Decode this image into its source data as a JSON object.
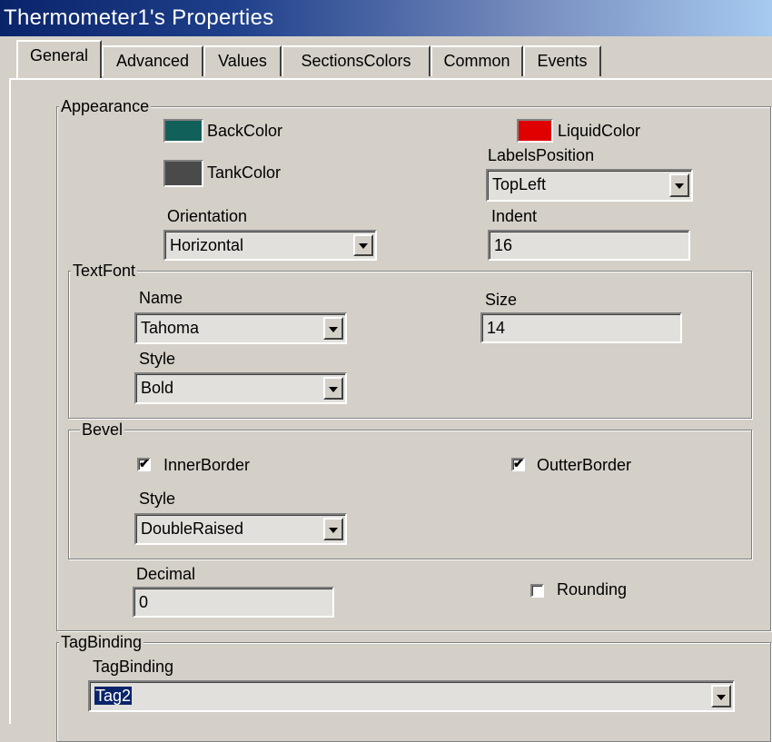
{
  "window": {
    "title": "Thermometer1's Properties"
  },
  "tabs": [
    {
      "label": "General",
      "active": true
    },
    {
      "label": "Advanced"
    },
    {
      "label": "Values"
    },
    {
      "label": "SectionsColors"
    },
    {
      "label": "Common"
    },
    {
      "label": "Events"
    }
  ],
  "appearance": {
    "group_label": "Appearance",
    "back_color": {
      "label": "BackColor",
      "color": "#12605a"
    },
    "tank_color": {
      "label": "TankColor",
      "color": "#4a4a4a"
    },
    "liquid_color": {
      "label": "LiquidColor",
      "color": "#e00000"
    },
    "labels_position": {
      "label": "LabelsPosition",
      "value": "TopLeft"
    },
    "orientation": {
      "label": "Orientation",
      "value": "Horizontal"
    },
    "indent": {
      "label": "Indent",
      "value": "16"
    }
  },
  "text_font": {
    "group_label": "TextFont",
    "name": {
      "label": "Name",
      "value": "Tahoma"
    },
    "size": {
      "label": "Size",
      "value": "14"
    },
    "style": {
      "label": "Style",
      "value": "Bold"
    }
  },
  "bevel": {
    "group_label": "Bevel",
    "inner_border": {
      "label": "InnerBorder",
      "checked": true,
      "mark": "✔"
    },
    "outter_border": {
      "label": "OutterBorder",
      "checked": true,
      "mark": "✔"
    },
    "style": {
      "label": "Style",
      "value": "DoubleRaised"
    }
  },
  "decimal": {
    "label": "Decimal",
    "value": "0"
  },
  "rounding": {
    "label": "Rounding",
    "checked": false
  },
  "tag_binding": {
    "group_label": "TagBinding",
    "label": "TagBinding",
    "value": "Tag2"
  }
}
